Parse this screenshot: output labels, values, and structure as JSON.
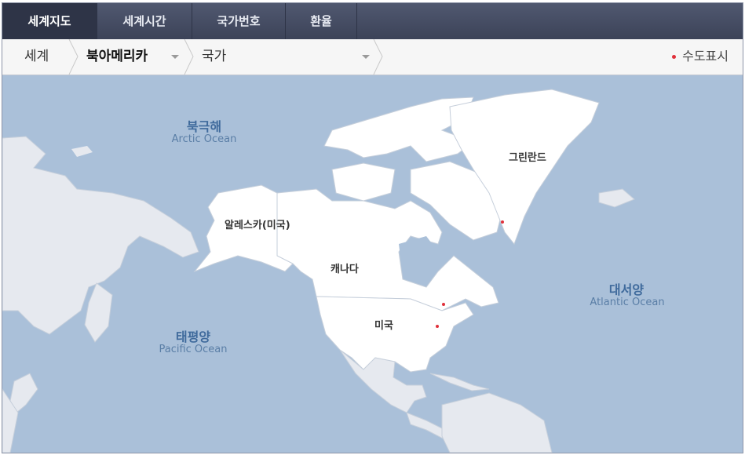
{
  "tabs": [
    {
      "label": "세계지도",
      "active": true
    },
    {
      "label": "세계시간",
      "active": false
    },
    {
      "label": "국가번호",
      "active": false
    },
    {
      "label": "환율",
      "active": false
    }
  ],
  "breadcrumb": {
    "world": "세계",
    "region": "북아메리카",
    "country_placeholder": "국가"
  },
  "capital_toggle": {
    "label": "수도표시"
  },
  "map": {
    "oceans": [
      {
        "ko": "북극해",
        "en": "Arctic Ocean"
      },
      {
        "ko": "태평양",
        "en": "Pacific Ocean"
      },
      {
        "ko": "대서양",
        "en": "Atlantic Ocean"
      }
    ],
    "countries": [
      "알레스카(미국)",
      "캐나다",
      "미국",
      "그린란드"
    ]
  },
  "colors": {
    "ocean": "#aac0d9",
    "land_highlight": "#ffffff",
    "land_other": "#e6e9ef",
    "capital_dot": "#e0303a",
    "tab_bar": "#474e65"
  }
}
